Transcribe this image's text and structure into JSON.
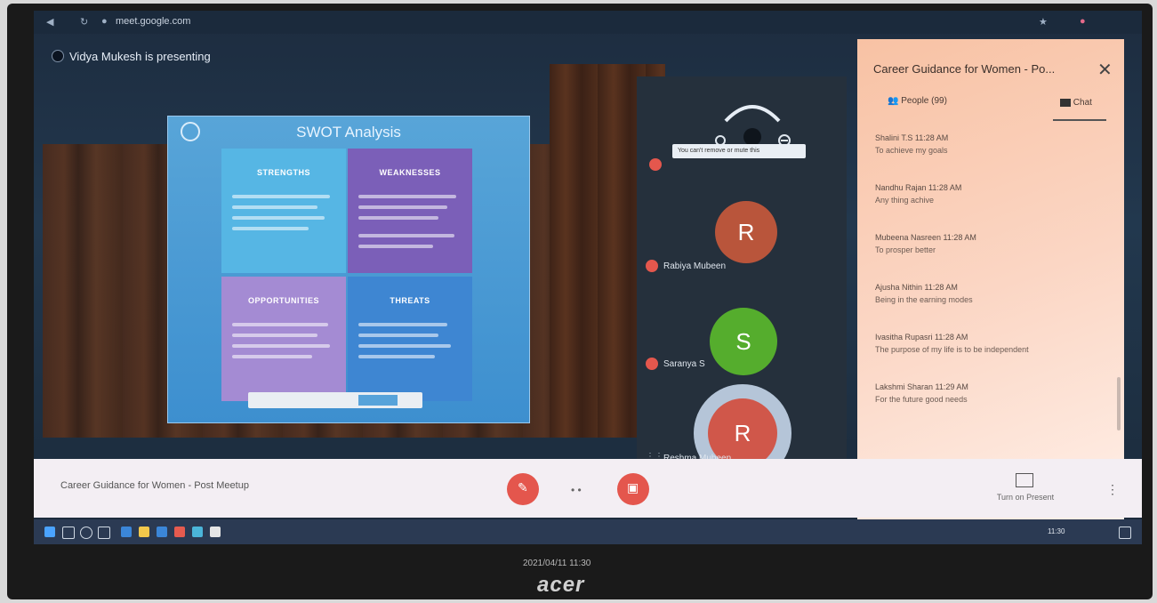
{
  "browser": {
    "url": "meet.google.com"
  },
  "presenting": {
    "text": "Vidya Mukesh is presenting"
  },
  "slide": {
    "title": "SWOT Analysis",
    "quadrants": [
      "STRENGTHS",
      "WEAKNESSES",
      "OPPORTUNITIES",
      "THREATS"
    ]
  },
  "participants": [
    {
      "initial": "R",
      "name": "Rabiya Mubeen",
      "color": "#b9553b"
    },
    {
      "initial": "S",
      "name": "Saranya S",
      "color": "#55ad2d"
    },
    {
      "initial": "R",
      "name": "Reshma Mubeen",
      "color": "#d0574a"
    }
  ],
  "tooltip": "You can't remove or mute this",
  "chat": {
    "title": "Career Guidance for Women - Po...",
    "tabs": {
      "people": "People (99)",
      "chat": "Chat"
    },
    "messages": [
      {
        "sender": "Shalini T.S  11:28 AM",
        "text": "To achieve my goals"
      },
      {
        "sender": "Nandhu Rajan  11:28 AM",
        "text": "Any thing achive"
      },
      {
        "sender": "Mubeena Nasreen  11:28 AM",
        "text": "To prosper better"
      },
      {
        "sender": "Ajusha Nithin  11:28 AM",
        "text": "Being in the earning modes"
      },
      {
        "sender": "Ivasitha Rupasri  11:28 AM",
        "text": "The purpose of my life is to be independent"
      },
      {
        "sender": "Lakshmi Sharan  11:29 AM",
        "text": "For the future good needs"
      }
    ]
  },
  "meeting": {
    "title": "Career Guidance for Women - Post Meetup",
    "present_label": "Turn on Present"
  },
  "taskbar": {
    "time": "11:30"
  },
  "monitor": {
    "stamp": "2021/04/11 11:30",
    "brand": "acer"
  }
}
